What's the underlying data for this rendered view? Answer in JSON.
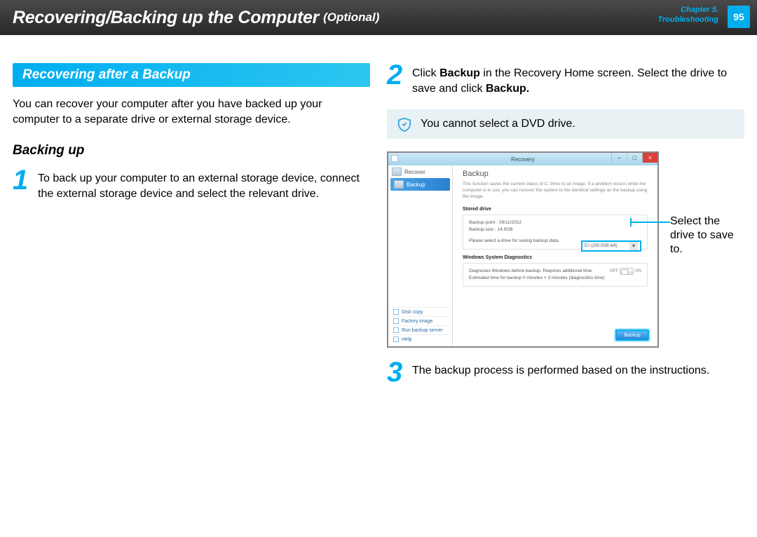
{
  "header": {
    "title_main": "Recovering/Backing up the Computer",
    "title_optional": "(Optional)",
    "chapter_line1": "Chapter 5.",
    "chapter_line2": "Troubleshooting",
    "page_num": "95"
  },
  "left": {
    "section_header": "Recovering after a Backup",
    "intro": "You can recover your computer after you have backed up your computer to a separate drive or external storage device.",
    "sub_header": "Backing up",
    "step1_num": "1",
    "step1_text": "To back up your computer to an external storage device, connect the external storage device and select the relevant drive."
  },
  "right": {
    "step2_num": "2",
    "step2_text_before": "Click ",
    "step2_bold1": "Backup",
    "step2_text_mid": " in the Recovery Home screen. Select the drive to save and click ",
    "step2_bold2": "Backup.",
    "note_text": "You cannot select a DVD drive.",
    "callout_text": "Select the drive to save to.",
    "step3_num": "3",
    "step3_text": "The backup process is performed based on the instructions."
  },
  "shot": {
    "window_title": "Recovery",
    "side_recover": "Recover",
    "side_backup": "Backup",
    "side_diskcopy": "Disk copy",
    "side_factory": "Factory image",
    "side_runserver": "Run backup server",
    "side_help": "Help",
    "main_h1": "Backup",
    "main_desc": "This function saves the current status of C: drive to an image.\nIf a problem occurs while the computer is in use, you can recover the system to the identical settings as the backup using the image.",
    "stored_drive": "Stored drive",
    "backup_point": "Backup point : 09/11/2012",
    "backup_size": "Backup size : 14.5GB",
    "select_msg": "Please select a drive for saving backup data.",
    "drive_label": "D:\\ (200.0GB left)",
    "diag_h": "Windows System Diagnostics",
    "diag_line1": "Diagnoses Windows before backup. Requires additional time.",
    "diag_line2": "Estimated time for backup 0 minutes + 3  minutes (diagnostics time)",
    "off": "OFF",
    "on": "ON",
    "backup_btn": "Backup"
  }
}
